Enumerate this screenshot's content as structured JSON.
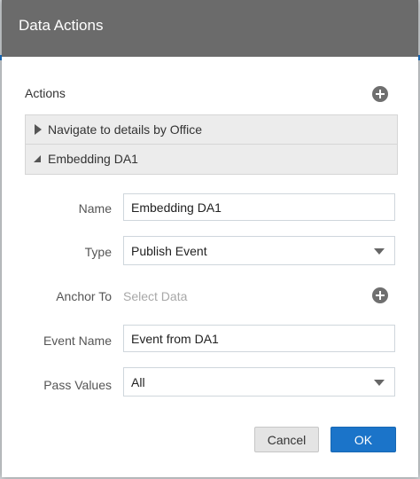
{
  "dialog": {
    "title": "Data Actions"
  },
  "actions": {
    "label": "Actions",
    "items": [
      {
        "label": "Navigate to details by Office",
        "expanded": false
      },
      {
        "label": "Embedding DA1",
        "expanded": true
      }
    ]
  },
  "form": {
    "name_label": "Name",
    "name_value": "Embedding DA1",
    "type_label": "Type",
    "type_value": "Publish Event",
    "anchor_label": "Anchor To",
    "anchor_placeholder": "Select Data",
    "event_name_label": "Event Name",
    "event_name_value": "Event from DA1",
    "pass_values_label": "Pass Values",
    "pass_values_value": "All"
  },
  "buttons": {
    "cancel": "Cancel",
    "ok": "OK"
  },
  "colors": {
    "titlebar": "#6b6b6b",
    "primary": "#1b74c9"
  }
}
